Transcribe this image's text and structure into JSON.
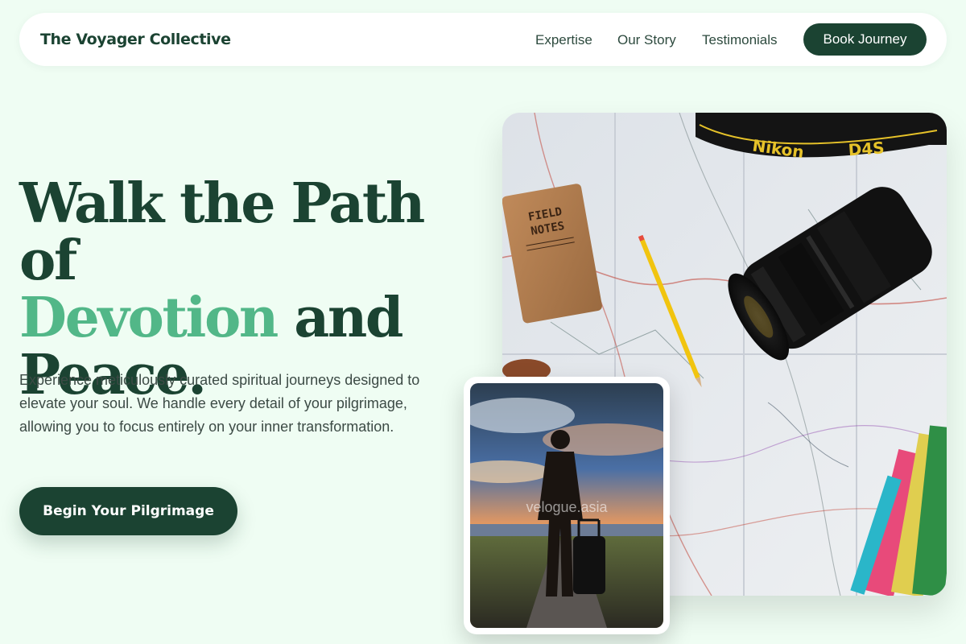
{
  "nav": {
    "brand": "The Voyager Collective",
    "links": [
      "Expertise",
      "Our Story",
      "Testimonials"
    ],
    "cta": "Book Journey"
  },
  "hero": {
    "headline_part1": "Walk the Path of",
    "headline_accent": "Devotion",
    "headline_part2": "and",
    "headline_part3": "Peace.",
    "description": "Experience meticulously curated spiritual journeys designed to elevate your soul. We handle every detail of your pilgrimage, allowing you to focus entirely on your inner transformation.",
    "cta": "Begin Your Pilgrimage"
  },
  "images": {
    "main_notebook_title_1": "FIELD",
    "main_notebook_title_2": "NOTES",
    "main_strap_text": "Nikon",
    "main_strap_model": "D4S",
    "inset_watermark": "velogue.asia"
  },
  "colors": {
    "primary": "#1b4332",
    "accent": "#52b788",
    "background": "#effdf3"
  }
}
